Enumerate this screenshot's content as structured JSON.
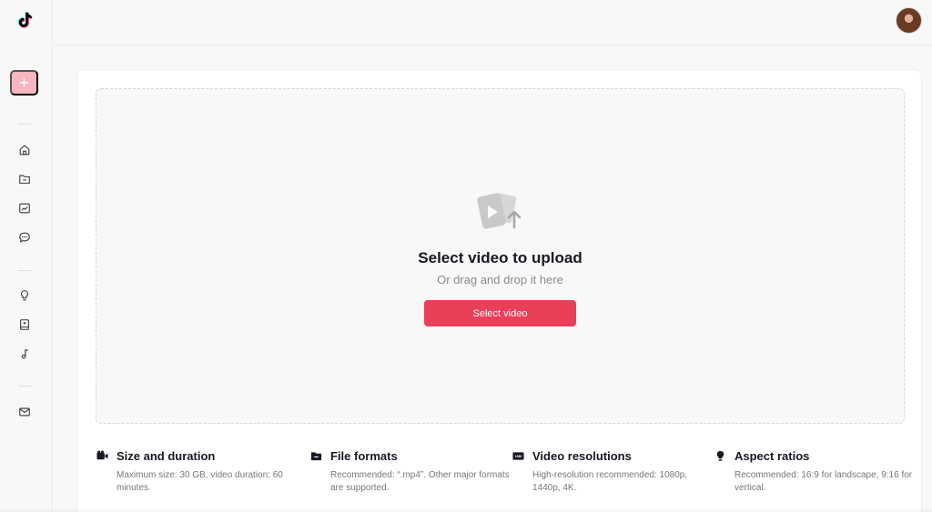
{
  "sidebar": {
    "logo_icon": "tiktok-logo-icon",
    "create_button": {
      "label": "+",
      "color": "#f7b6c0"
    },
    "items": [
      {
        "id": "home",
        "icon": "home-icon"
      },
      {
        "id": "content",
        "icon": "folder-icon"
      },
      {
        "id": "analytics",
        "icon": "analytics-icon"
      },
      {
        "id": "comments",
        "icon": "comment-icon"
      },
      {
        "id": "inspirations",
        "icon": "lightbulb-icon"
      },
      {
        "id": "academy",
        "icon": "book-icon"
      },
      {
        "id": "sounds",
        "icon": "music-note-icon"
      },
      {
        "id": "feedback",
        "icon": "mail-icon"
      }
    ]
  },
  "header": {
    "avatar_icon": "user-avatar"
  },
  "upload": {
    "icon": "video-upload-icon",
    "title": "Select video to upload",
    "subtitle": "Or drag and drop it here",
    "button_label": "Select video",
    "accent": "#ea3f59"
  },
  "info": [
    {
      "icon": "video-camera-icon",
      "title": "Size and duration",
      "desc": "Maximum size: 30 GB, video duration: 60 minutes."
    },
    {
      "icon": "folder-icon",
      "title": "File formats",
      "desc": "Recommended: “.mp4”. Other major formats are supported."
    },
    {
      "icon": "resolution-icon",
      "title": "Video resolutions",
      "desc": "High-resolution recommended: 1080p, 1440p, 4K."
    },
    {
      "icon": "lightbulb-icon",
      "title": "Aspect ratios",
      "desc": "Recommended: 16:9 for landscape, 9:16 for vertical."
    }
  ]
}
